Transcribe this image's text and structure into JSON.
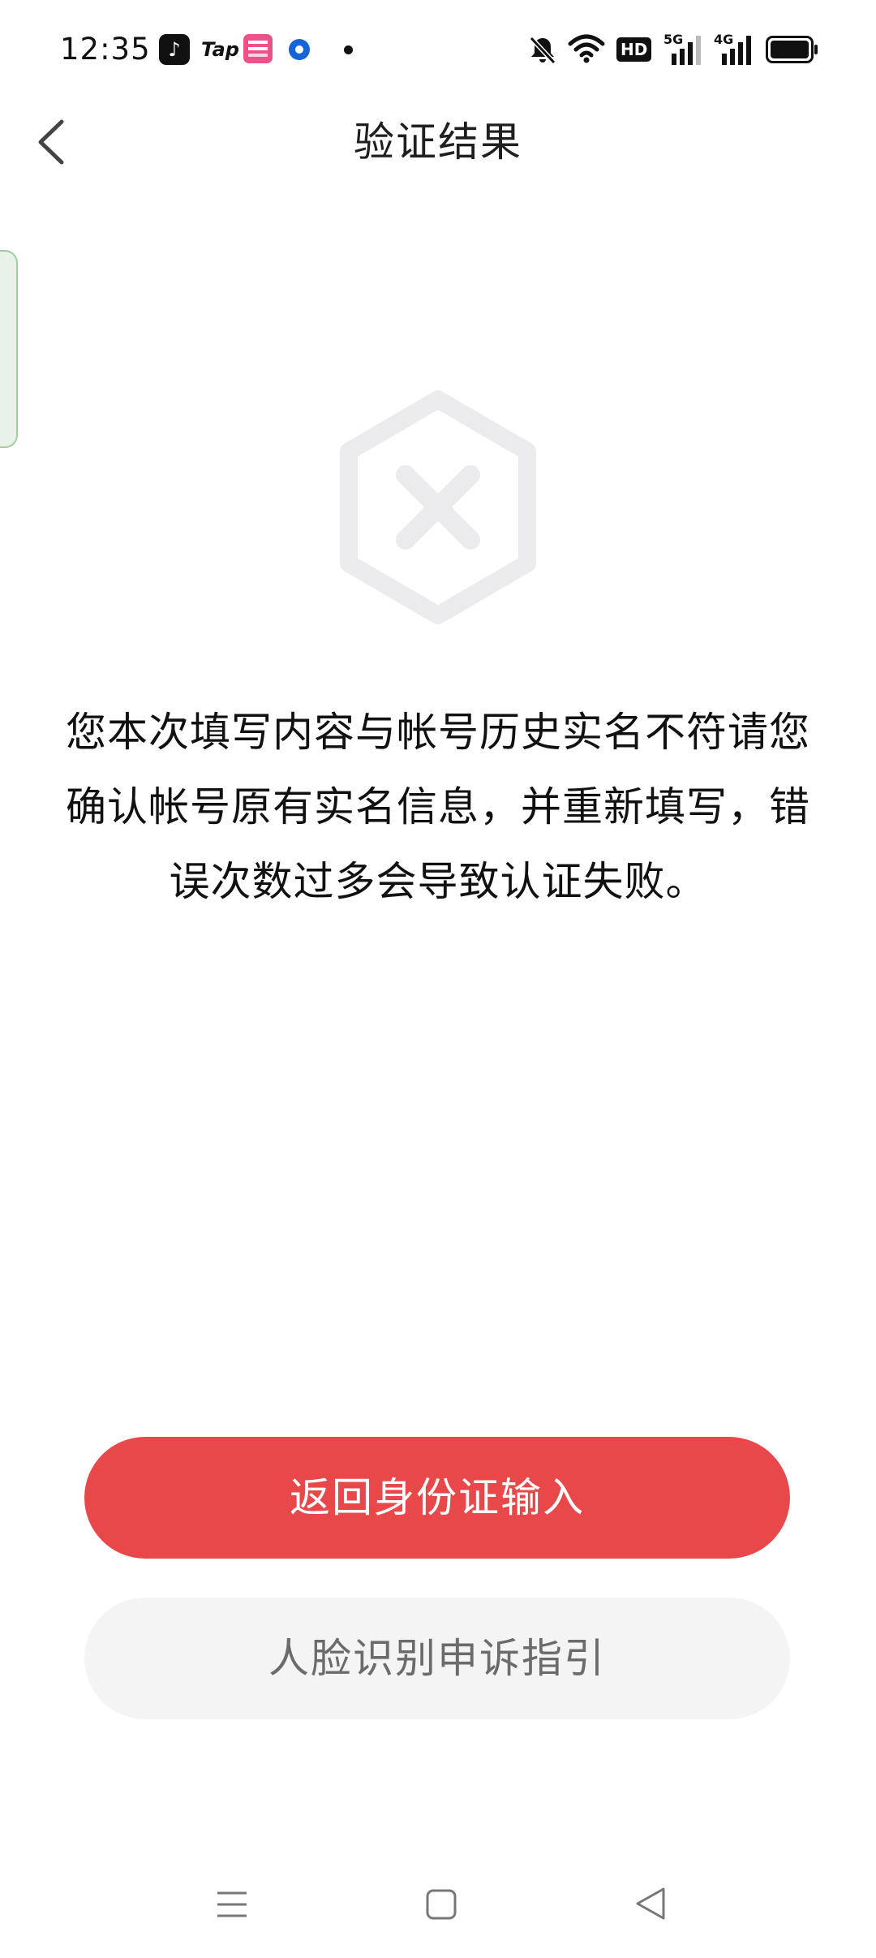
{
  "status_bar": {
    "time": "12:35",
    "app_icons": [
      "tiktok-icon",
      "tap-icon",
      "vip-app-icon",
      "blue-circle-app-icon"
    ],
    "tap_label": "Tap",
    "hd_label": "HD",
    "sig5g_label": "5G",
    "sig4g_label": "4G",
    "system_icons": [
      "mute-icon",
      "wifi-icon",
      "hd-icon",
      "signal-5g-icon",
      "signal-4g-icon",
      "battery-icon"
    ]
  },
  "header": {
    "title": "验证结果",
    "back_icon": "chevron-left-icon"
  },
  "result": {
    "icon": "hexagon-x-icon",
    "message": "您本次填写内容与帐号历史实名不符请您确认帐号原有实名信息，并重新填写，错误次数过多会导致认证失败。"
  },
  "actions": {
    "primary_label": "返回身份证输入",
    "secondary_label": "人脸识别申诉指引"
  },
  "colors": {
    "primary": "#e9484b",
    "secondary_bg": "#f4f4f4",
    "icon_gray": "#ebebed"
  },
  "bottom_nav": {
    "icons": [
      "menu-icon",
      "home-square-icon",
      "back-triangle-icon"
    ]
  }
}
